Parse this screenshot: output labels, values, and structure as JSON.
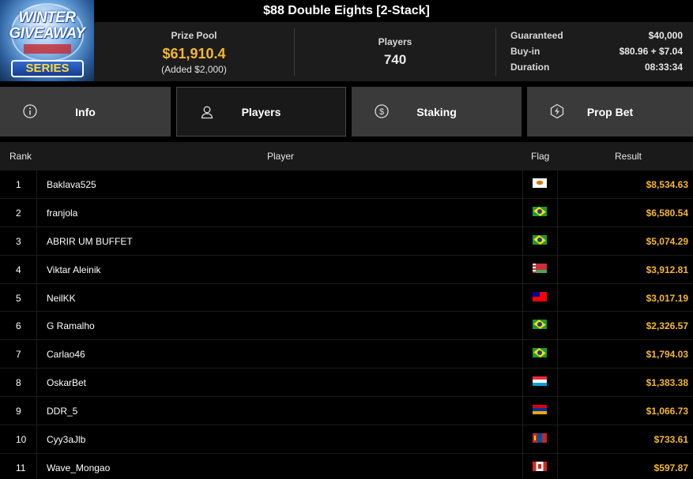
{
  "title": "$88 Double Eights [2-Stack]",
  "logo": {
    "line1": "WINTER",
    "line2": "GIVEAWAY",
    "series": "SERIES"
  },
  "prize_pool": {
    "label": "Prize Pool",
    "value": "$61,910.4",
    "added": "(Added $2,000)"
  },
  "players_stat": {
    "label": "Players",
    "value": "740"
  },
  "details": [
    {
      "label": "Guaranteed",
      "value": "$40,000"
    },
    {
      "label": "Buy-in",
      "value": "$80.96 + $7.04"
    },
    {
      "label": "Duration",
      "value": "08:33:34"
    }
  ],
  "tabs": [
    {
      "label": "Info",
      "icon": "info-icon"
    },
    {
      "label": "Players",
      "icon": "user-icon",
      "active": true
    },
    {
      "label": "Staking",
      "icon": "dollar-coin-icon"
    },
    {
      "label": "Prop Bet",
      "icon": "lightning-icon"
    }
  ],
  "table": {
    "headers": {
      "rank": "Rank",
      "player": "Player",
      "flag": "Flag",
      "result": "Result"
    },
    "rows": [
      {
        "rank": "1",
        "player": "Baklava525",
        "flag": "cyprus",
        "result": "$8,534.63"
      },
      {
        "rank": "2",
        "player": "franjola",
        "flag": "brazil",
        "result": "$6,580.54"
      },
      {
        "rank": "3",
        "player": "ABRIR UM BUFFET",
        "flag": "brazil",
        "result": "$5,074.29"
      },
      {
        "rank": "4",
        "player": "Viktar Aleinik",
        "flag": "belarus",
        "result": "$3,912.81"
      },
      {
        "rank": "5",
        "player": "NeilKK",
        "flag": "taiwan",
        "result": "$3,017.19"
      },
      {
        "rank": "6",
        "player": "G Ramalho",
        "flag": "brazil",
        "result": "$2,326.57"
      },
      {
        "rank": "7",
        "player": "Carlao46",
        "flag": "brazil",
        "result": "$1,794.03"
      },
      {
        "rank": "8",
        "player": "OskarBet",
        "flag": "luxembourg",
        "result": "$1,383.38"
      },
      {
        "rank": "9",
        "player": "DDR_5",
        "flag": "armenia",
        "result": "$1,066.73"
      },
      {
        "rank": "10",
        "player": "Cyy3aJlb",
        "flag": "mongolia",
        "result": "$733.61"
      },
      {
        "rank": "11",
        "player": "Wave_Mongao",
        "flag": "canada",
        "result": "$597.87"
      }
    ]
  },
  "colors": {
    "accent_gold": "#f5b731",
    "tab_bg": "#3a3a3a",
    "header_bg": "#1c1c1c"
  }
}
